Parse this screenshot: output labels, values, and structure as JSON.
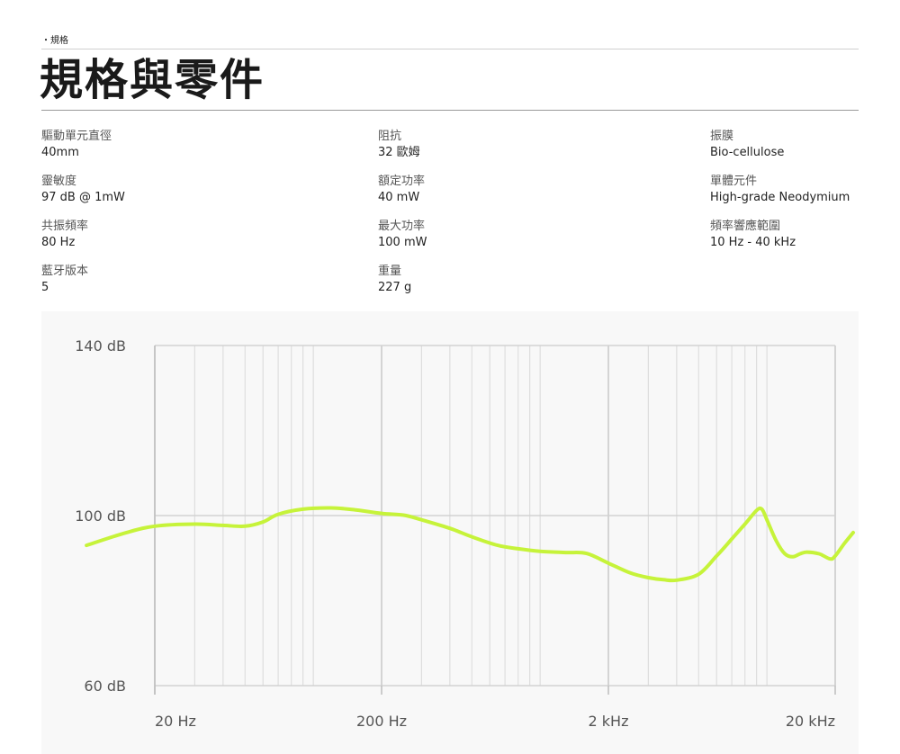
{
  "breadcrumb": "・規格",
  "title": "規格與零件",
  "specs": {
    "col1": [
      {
        "label": "驅動單元直徑",
        "value": "40mm"
      },
      {
        "label": "靈敏度",
        "value": "97 dB @ 1mW"
      },
      {
        "label": "共振頻率",
        "value": "80 Hz"
      },
      {
        "label": "藍牙版本",
        "value": "5"
      }
    ],
    "col2": [
      {
        "label": "阻抗",
        "value": "32 歐姆"
      },
      {
        "label": "額定功率",
        "value": "40 mW"
      },
      {
        "label": "最大功率",
        "value": "100 mW"
      },
      {
        "label": "重量",
        "value": "227 g"
      }
    ],
    "col3": [
      {
        "label": "振膜",
        "value": "Bio-cellulose"
      },
      {
        "label": "單體元件",
        "value": "High-grade Neodymium"
      },
      {
        "label": "頻率響應範圍",
        "value": "10 Hz - 40 kHz"
      }
    ]
  },
  "chart_data": {
    "type": "line",
    "title": "",
    "xlabel": "",
    "ylabel": "",
    "x_scale": "log",
    "xlim": [
      10,
      40000
    ],
    "ylim": [
      60,
      140
    ],
    "x_ticks": [
      {
        "value": 20,
        "label": "20 Hz"
      },
      {
        "value": 200,
        "label": "200 Hz"
      },
      {
        "value": 2000,
        "label": "2 kHz"
      },
      {
        "value": 20000,
        "label": "20 kHz"
      }
    ],
    "y_ticks": [
      {
        "value": 140,
        "label": "140 dB"
      },
      {
        "value": 100,
        "label": "100 dB"
      },
      {
        "value": 60,
        "label": "60 dB"
      }
    ],
    "grid": true,
    "line_color": "#c6f33a",
    "series": [
      {
        "x": [
          10,
          15,
          20,
          30,
          40,
          50,
          60,
          70,
          90,
          120,
          150,
          200,
          250,
          300,
          400,
          500,
          650,
          800,
          1000,
          1300,
          1600,
          2000,
          2500,
          3000,
          3500,
          4000,
          5000,
          6000,
          7000,
          8000,
          9000,
          9500,
          10000,
          11000,
          12000,
          13000,
          14000,
          15000,
          17000,
          19000,
          20000,
          22000,
          24000
        ],
        "y": [
          93,
          96,
          97.5,
          98,
          97.7,
          97.5,
          98.5,
          100.3,
          101.5,
          101.8,
          101.4,
          100.5,
          100.1,
          99,
          97,
          95,
          93,
          92.2,
          91.6,
          91.3,
          91.1,
          88.8,
          86.5,
          85.4,
          84.9,
          84.8,
          86.2,
          90.5,
          94.5,
          98,
          101.2,
          101.5,
          99,
          94,
          91,
          90.3,
          91,
          91.4,
          91,
          89.8,
          90.5,
          93.5,
          96
        ]
      }
    ]
  }
}
